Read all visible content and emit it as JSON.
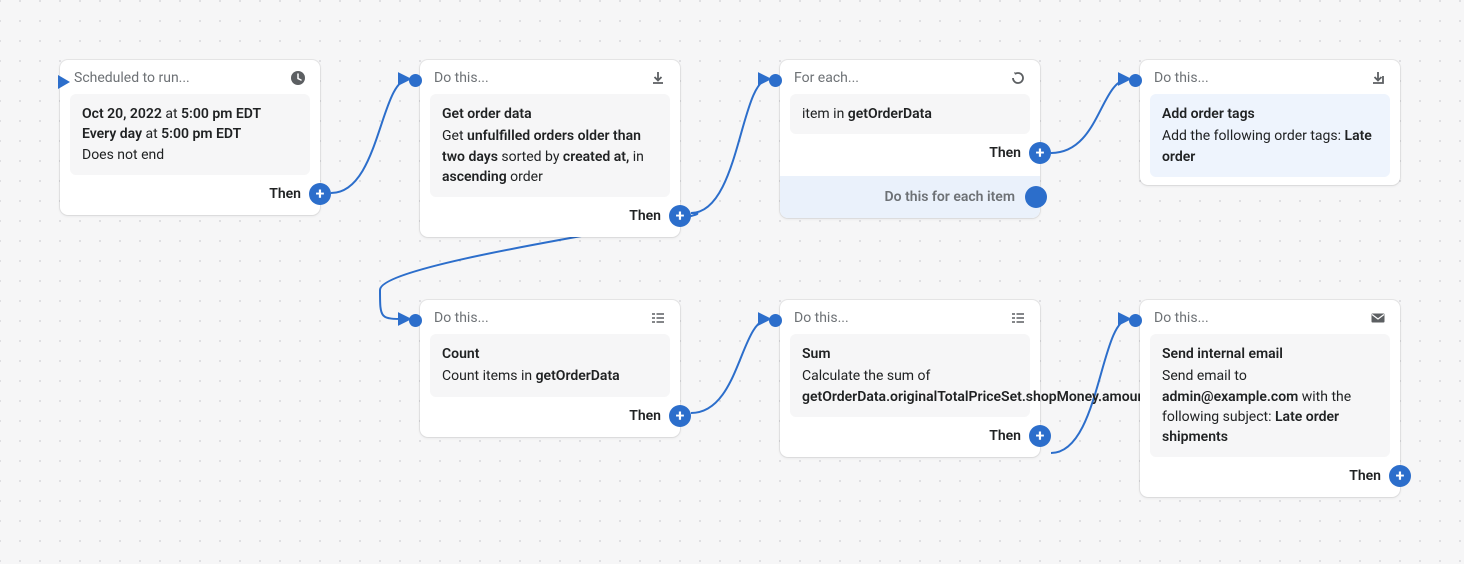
{
  "then_label": "Then",
  "nodes": {
    "start": {
      "header": "Scheduled to run...",
      "date": "Oct 20, 2022",
      "at1": " at ",
      "time1": "5:00 pm EDT",
      "everyday": "Every day",
      "at2": " at ",
      "time2": "5:00 pm EDT",
      "noend": "Does not end"
    },
    "getOrder": {
      "header": "Do this...",
      "title": "Get order data",
      "p1": "Get ",
      "b1": "unfulfilled orders older than two days",
      "p2": " sorted by ",
      "b2": "created at,",
      "p3": " in ",
      "b3": "ascending",
      "p4": " order"
    },
    "forEach": {
      "header": "For each...",
      "body_pre": "item in ",
      "body_b": "getOrderData",
      "bar": "Do this for each item"
    },
    "addTags": {
      "header": "Do this...",
      "title": "Add order tags",
      "p1": "Add the following order tags: ",
      "b1": "Late order"
    },
    "count": {
      "header": "Do this...",
      "title": "Count",
      "p1": "Count items in ",
      "b1": "getOrderData"
    },
    "sum": {
      "header": "Do this...",
      "title": "Sum",
      "p1": "Calculate the sum of ",
      "b1": "getOrderData.originalTotalPriceSet.shopMoney.amount"
    },
    "email": {
      "header": "Do this...",
      "title": "Send internal email",
      "p1": "Send email to ",
      "b1": "admin@example.com",
      "p2": " with the following subject: ",
      "b2": "Late order shipments"
    }
  }
}
